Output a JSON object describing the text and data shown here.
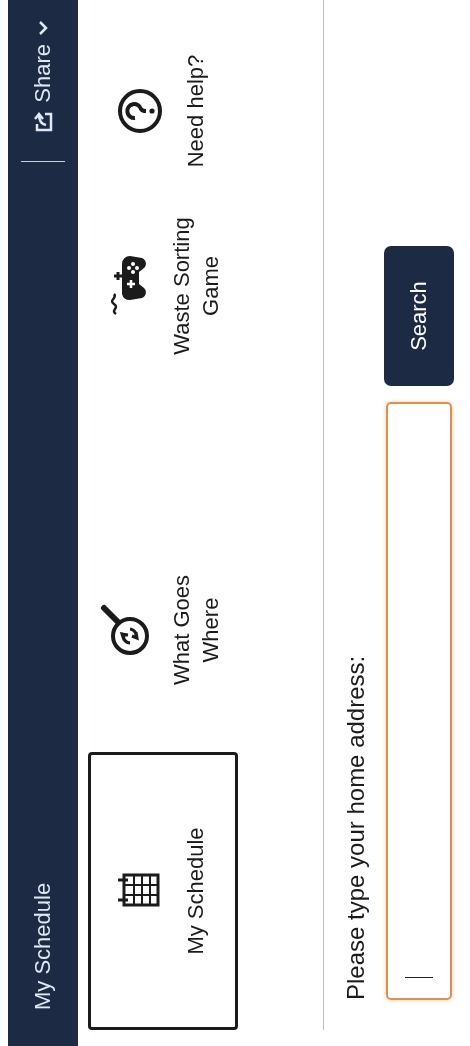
{
  "header": {
    "title": "My Schedule",
    "share": {
      "label": "Share"
    }
  },
  "tiles": [
    {
      "kind": "calendar",
      "label": "My Schedule",
      "selected": true
    },
    {
      "kind": "search",
      "label": "What Goes Where",
      "selected": false
    },
    {
      "kind": "game",
      "label": "Waste Sorting Game",
      "selected": false
    },
    {
      "kind": "help",
      "label": "Need help?",
      "selected": false
    }
  ],
  "address": {
    "label": "Please type your home address:",
    "focused": true
  },
  "search_button": {
    "label": "Search"
  }
}
